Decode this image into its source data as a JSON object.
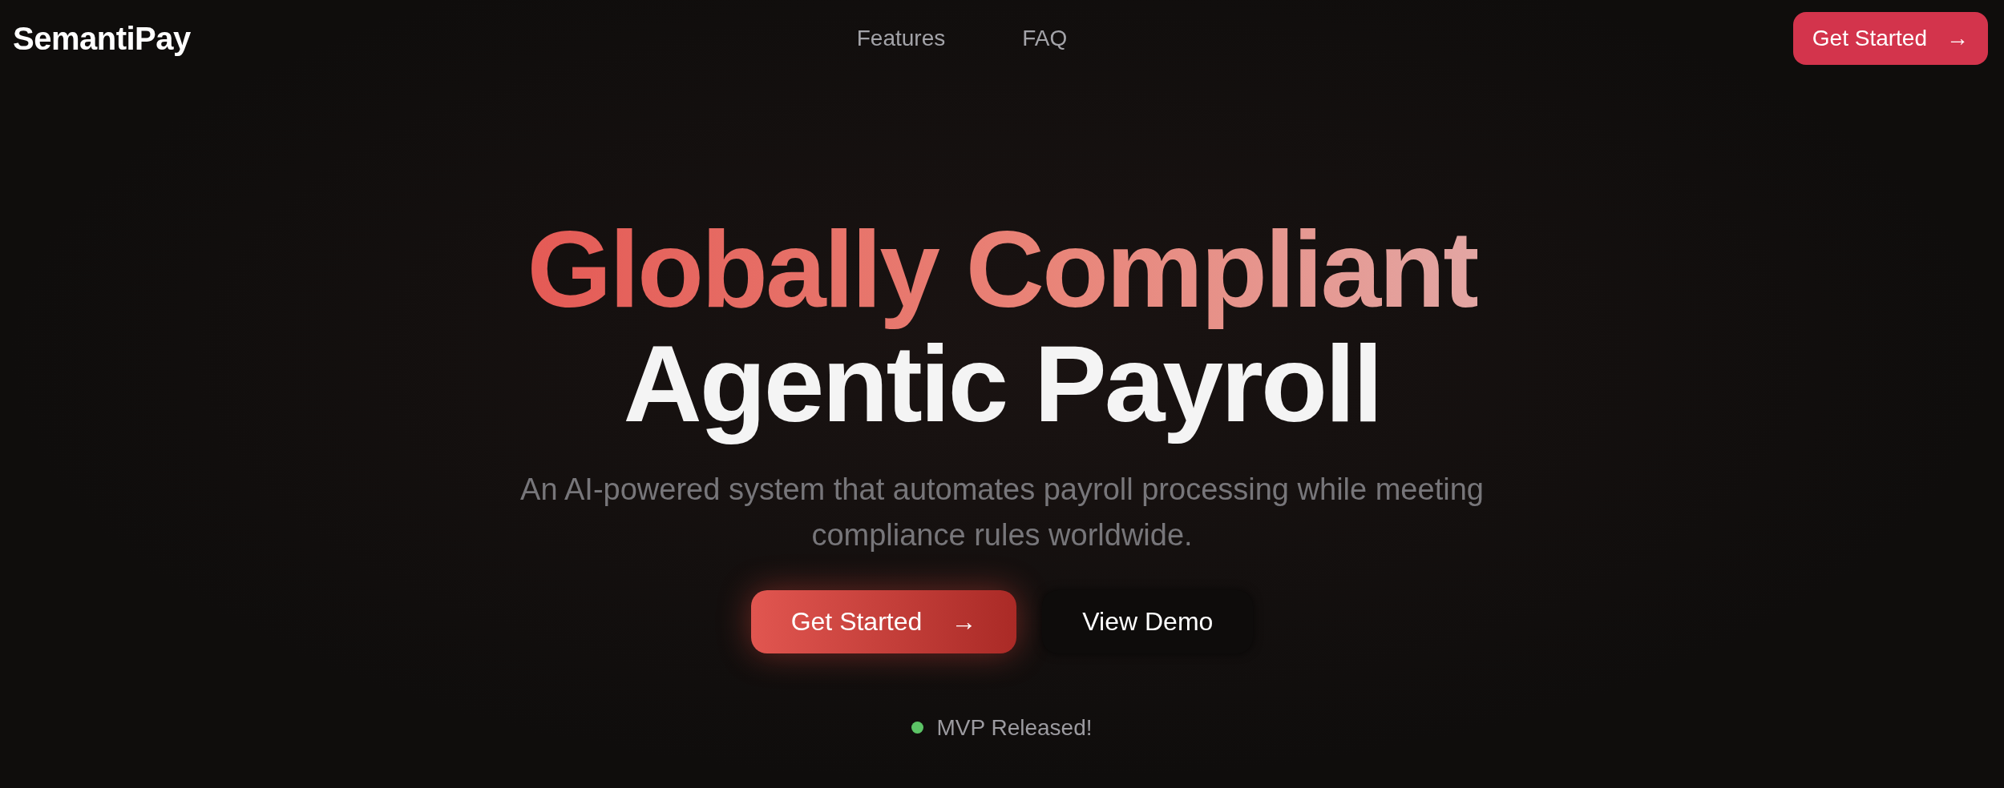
{
  "header": {
    "logo": "SemantiPay",
    "nav": [
      {
        "label": "Features"
      },
      {
        "label": "FAQ"
      }
    ],
    "cta": {
      "label": "Get Started",
      "icon": "→"
    }
  },
  "hero": {
    "headline_accent": "Globally Compliant",
    "headline_main": "Agentic Payroll",
    "subtitle": "An AI-powered system that automates payroll processing while meeting compliance rules worldwide.",
    "buttons": [
      {
        "kind": "primary",
        "label": "Get Started",
        "icon": "→"
      },
      {
        "kind": "secondary",
        "label": "View Demo"
      }
    ],
    "status": {
      "label": "MVP Released!"
    }
  }
}
